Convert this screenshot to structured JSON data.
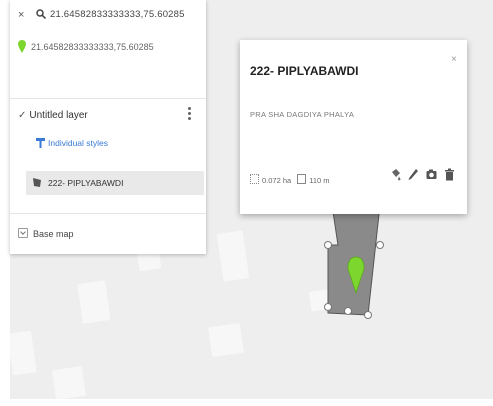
{
  "search": {
    "close_glyph": "×",
    "query": "21.64582833333333,75.60285"
  },
  "search_result": {
    "text": "21.64582833333333,75.60285",
    "pin_color": "#7cd62e"
  },
  "layer": {
    "check_glyph": "✓",
    "title": "Untitled layer",
    "styles_link": "Individual styles",
    "feature_label": "222- PIPLYABAWDI"
  },
  "basemap": {
    "label": "Base map"
  },
  "popup": {
    "title": "222- PIPLYABAWDI",
    "close_glyph": "×",
    "description": "PRA SHA DAGDIYA PHALYA",
    "area": "0.072 ha",
    "perimeter": "110 m",
    "tools": [
      "paint-bucket-icon",
      "pencil-icon",
      "camera-icon",
      "trash-icon"
    ]
  },
  "colors": {
    "accent_link": "#3a7bd5",
    "polygon_fill": "#8a8a8a",
    "marker_green": "#7cd62e"
  }
}
